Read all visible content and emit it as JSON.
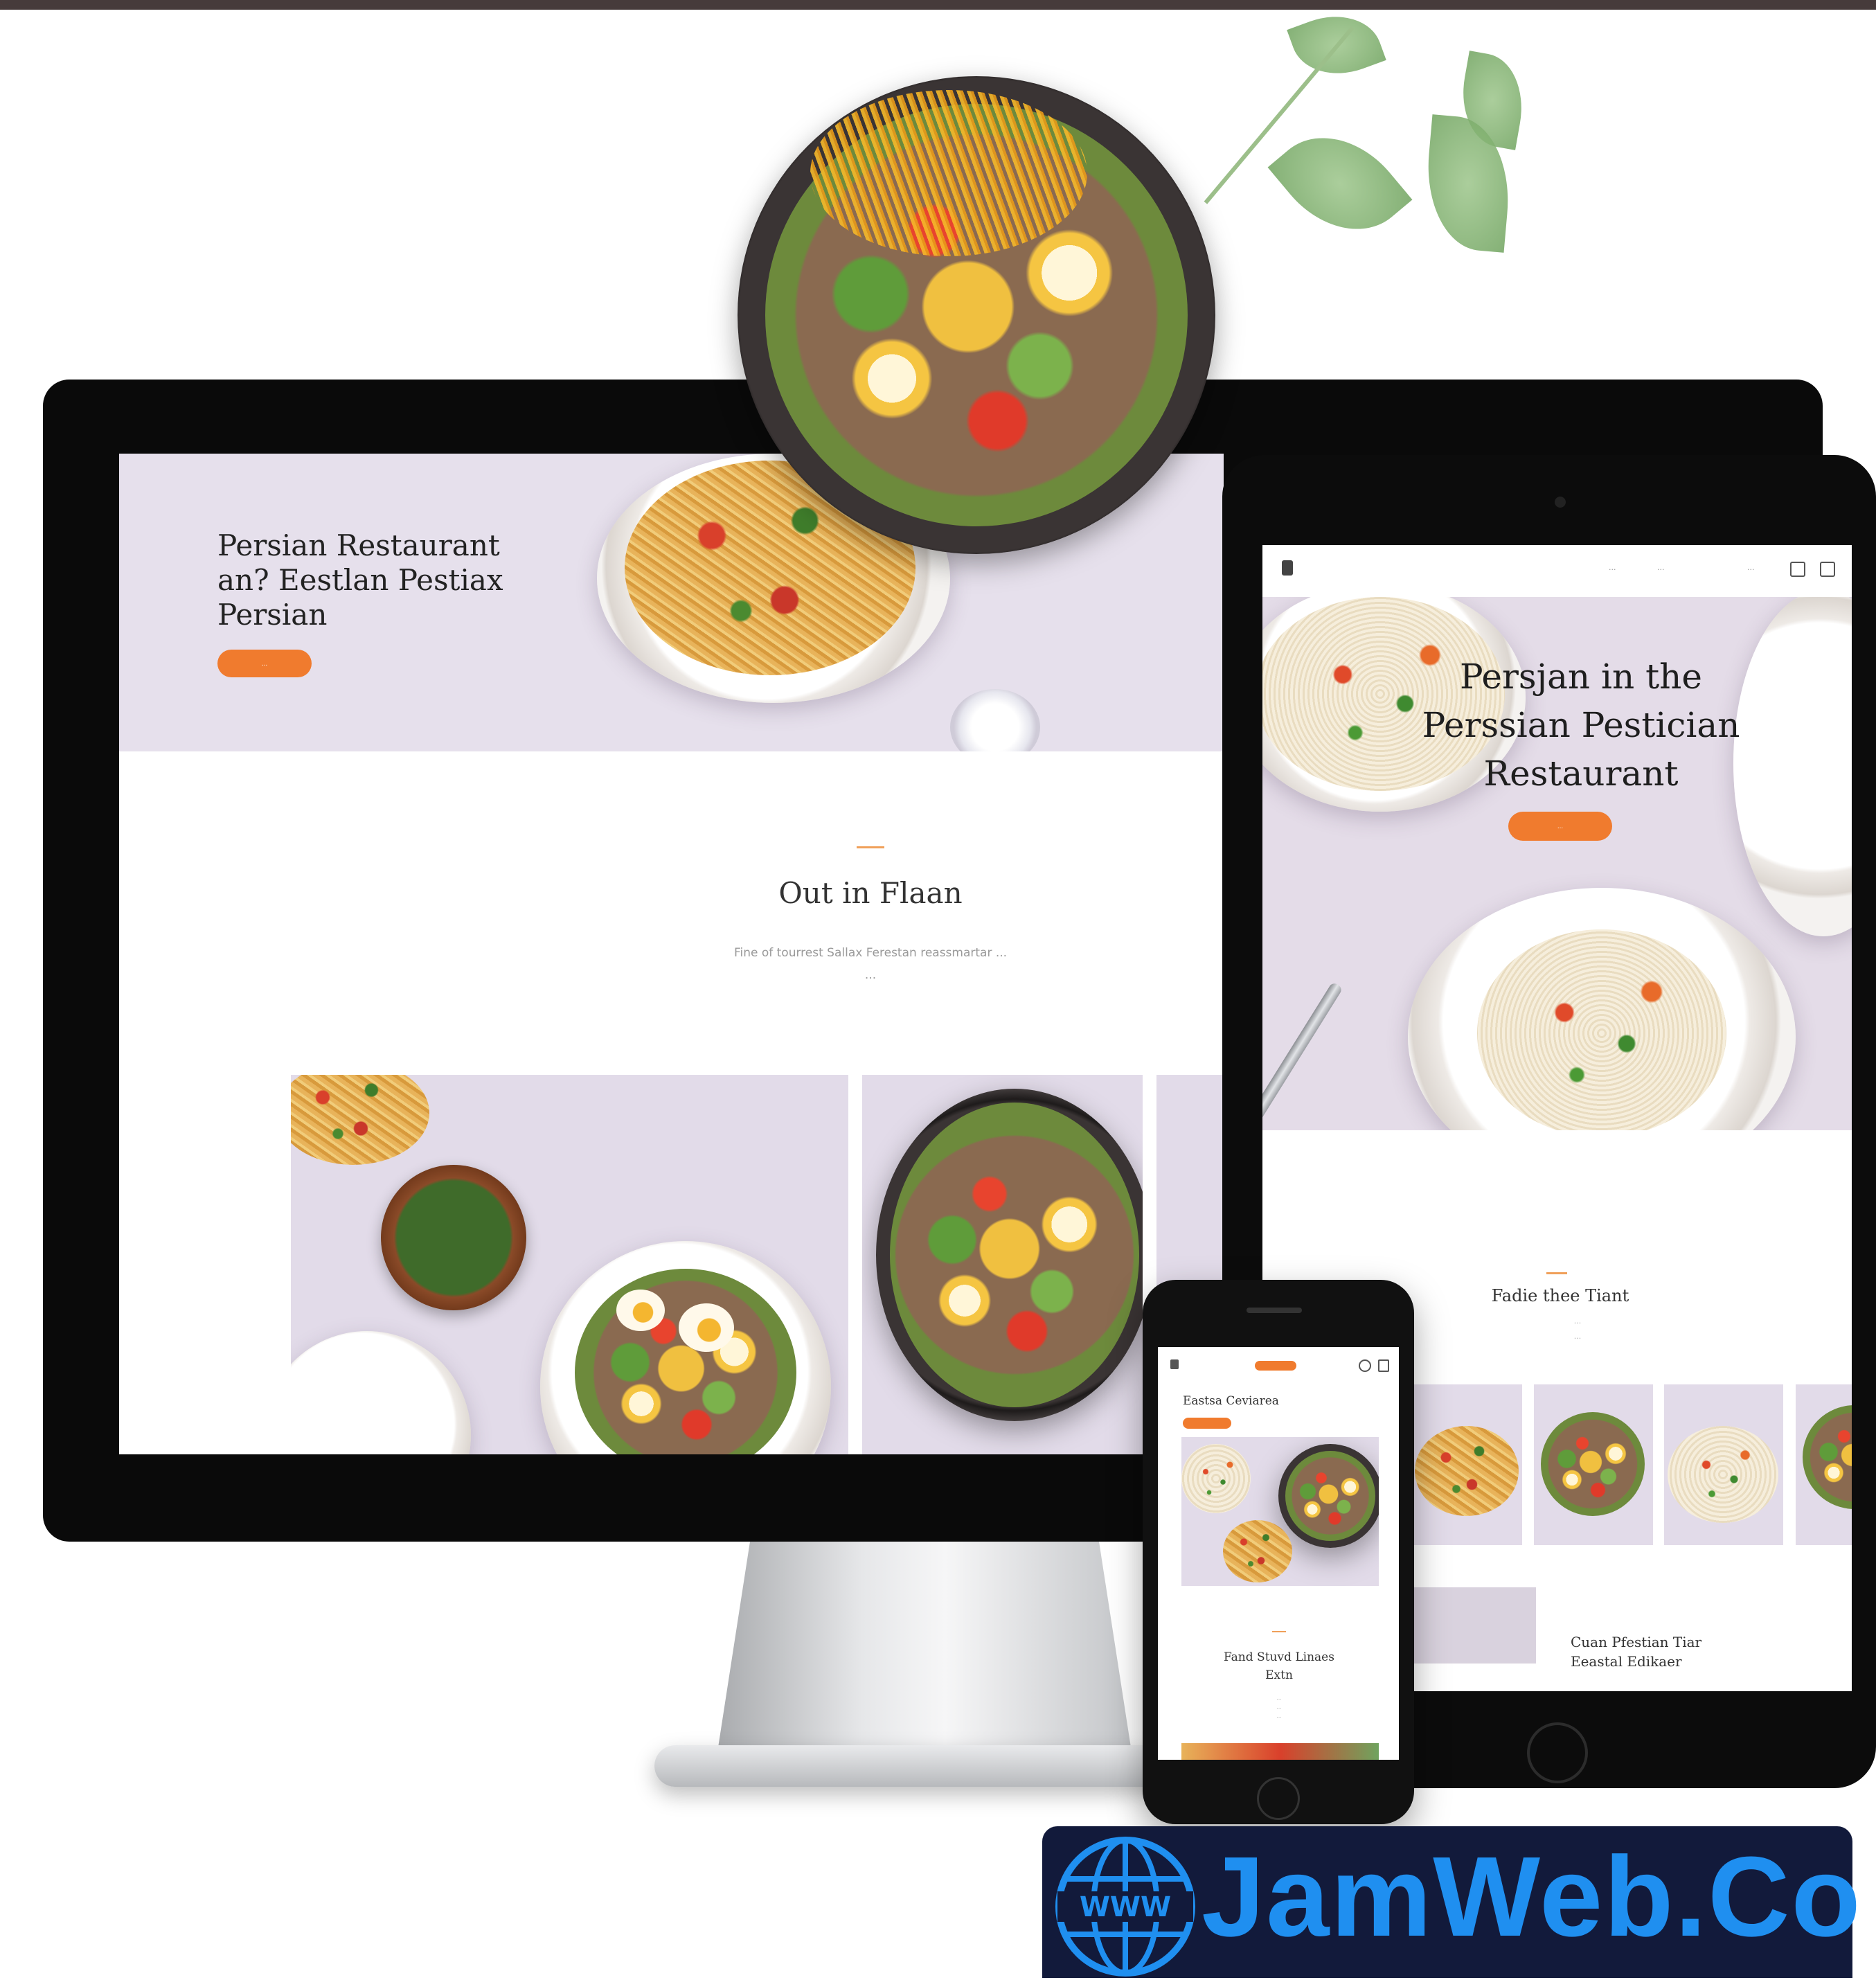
{
  "desktop": {
    "hero": {
      "title_lines": [
        "Persian Restaurant",
        "an? Eestlan Pestiax",
        "Persian"
      ],
      "button_label": "..."
    },
    "section": {
      "title": "Out in Flaan",
      "text_lines": [
        "Fine of tourrest Sallax Ferestan reassmartar ...",
        "..."
      ]
    }
  },
  "tablet": {
    "nav": {
      "links": [
        "...",
        "...",
        "..."
      ]
    },
    "hero": {
      "title_lines": [
        "Persjan in the",
        "Perssian Pestician",
        "Restaurant"
      ],
      "button_label": "..."
    },
    "section": {
      "title": "Fadie thee Tiant",
      "text_lines": [
        "...",
        "..."
      ]
    },
    "bottom_title_lines": [
      "Cuan Pfestian Tiar",
      "Eeastal Edikaer"
    ]
  },
  "phone": {
    "title": "Eastsa Ceviarea",
    "section": {
      "title_lines": [
        "Fand Stuvd Linaes",
        "Extn"
      ],
      "text_lines": [
        "...",
        "...",
        "..."
      ]
    }
  },
  "brand": {
    "text": "JamWeb.Co",
    "globe_label": "WWW",
    "color": "#1f8ff0",
    "background": "#121a3b"
  },
  "colors": {
    "accent": "#f07b2e",
    "hero_bg": "#e6e0ec"
  }
}
